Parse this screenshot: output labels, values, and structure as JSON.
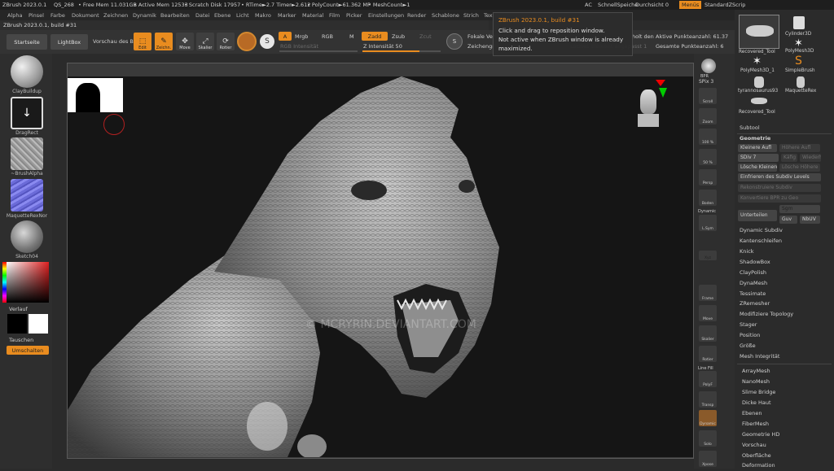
{
  "status": {
    "app": "ZBrush 2023.0.1",
    "qs": "QS_268",
    "free_mem": "• Free Mem 11.031GB",
    "active_mem": "• Active Mem 12533",
    "scratch": "• Scratch Disk 17957",
    "rtime": "• RTime►2.7 Timer►2.612",
    "polycount": "• PolyCount►61.362 MP",
    "meshcount": "• MeshCount►1",
    "ac": "AC",
    "schnell": "SchnellSpeiche",
    "durchsicht": "Durchsicht 0",
    "menues": "Menüs",
    "standard": "StandardZScrip"
  },
  "menu": [
    "Alpha",
    "Pinsel",
    "Farbe",
    "Dokument",
    "Zeichnen",
    "Dynamik",
    "Bearbeiten",
    "Datei",
    "Ebene",
    "Licht",
    "Makro",
    "Marker",
    "Material",
    "Film",
    "Picker",
    "Einstellungen",
    "Render",
    "Schablone",
    "Strich",
    "Tex"
  ],
  "subtitle": "ZBrush 2023.0.1, build #31",
  "toolbar": {
    "startseite": "Startseite",
    "lightbox": "LightBox",
    "vorschau": "Vorschau des Bi",
    "edit": "Edit",
    "zeichnen": "Zeichn.",
    "move": "Move",
    "skalier": "Skalier",
    "rotier": "Rotier",
    "a": "A",
    "mrgb": "Mrgb",
    "rgb": "RGB",
    "m": "M",
    "zadd": "Zadd",
    "zsub": "Zsub",
    "zcut": "Zcut",
    "rgb_intensitat": "RGB Intensität",
    "z_intensitat": "Z Intensität 50",
    "fokale": "Fokale Ver",
    "zeichengr": "Zeichengr",
    "letztes": "Letztes Element angepasst 1",
    "aktive": "Aktive Punkteanzahl: 61.37",
    "gesamte": "Gesamte Punkteanzahl: 6",
    "holt_den": "holt den"
  },
  "tooltip": {
    "title": "ZBrush 2023.0.1, build #31",
    "line1": "Click and drag to reposition window.",
    "line2": "Not active when ZBrush window is already",
    "line3": "maximized."
  },
  "left": {
    "clay": "ClayBuildup",
    "drag": "DragRect",
    "alpha": "~BrushAlpha",
    "maquette": "MaquetteRexNor",
    "sketch": "Sketch04",
    "verlauf": "Verlauf",
    "tauschen": "Tauschen",
    "umschalten": "Umschalten"
  },
  "rightcol": {
    "bpr": "BPR",
    "spix": "SPix 3",
    "scroll": "Scroll",
    "zoom": "Zoom",
    "p100": "100 %",
    "p50": "50 %",
    "persp": "Persp",
    "boden": "Boden",
    "dynamic": "Dynamic",
    "lsym": "L.Sym",
    "xyz": "Xyz",
    "frame": "Frame",
    "move": "Move",
    "skalier": "Skalier",
    "rotier": "Rotier",
    "linefill": "Line Fill",
    "polyf": "PolyF",
    "transp": "Transp",
    "dynamic2": "Dynamic",
    "solo": "Solo",
    "xpose": "Xpose"
  },
  "tools": {
    "recovered1": "Recovered_Tool",
    "cylinder": "Cylinder3D",
    "poly1": "PolyMesh3D_1",
    "simple": "SimpleBrush",
    "poly": "PolyMesh3D",
    "tyranno": "tyrannosaurus93",
    "maquette": "MaquetteRex",
    "recovered2": "Recovered_Tool"
  },
  "panel": {
    "subtool": "Subtool",
    "geometrie": "Geometrie",
    "kleinere": "Kleinere Aufl",
    "hohere": "Höhere Aufl",
    "sdiv": "SDiv 7",
    "kafig": "Käfig",
    "wiederh": "Wiederh",
    "losche_kl": "Lösche Kleinere",
    "losche_ho": "Lösche Höhere",
    "einfrieren": "Einfrieren des Subdiv Levels",
    "rekonstr": "Rekonstruiere Subdiv",
    "konvert": "Konvertiere BPR zu Geo",
    "unterteilen": "Unterteilen",
    "sgm": "Sgm",
    "guv": "Guv",
    "nbuv": "NbUV",
    "items": [
      "Dynamic Subdiv",
      "Kantenschleifen",
      "Knick",
      "ShadowBox",
      "ClayPolish",
      "DynaMesh",
      "Tessimate",
      "ZRemesher",
      "Modifiziere Topology",
      "Stager",
      "Position",
      "Größe",
      "Mesh Integrität"
    ],
    "items2": [
      "ArrayMesh",
      "NanoMesh",
      "Slime Bridge",
      "Dicke Haut",
      "Ebenen",
      "FiberMesh",
      "Geometrie HD",
      "Vorschau",
      "Oberfläche",
      "Deformation"
    ]
  },
  "watermark": "© MCRYRIN.DEVIANTART.COM"
}
